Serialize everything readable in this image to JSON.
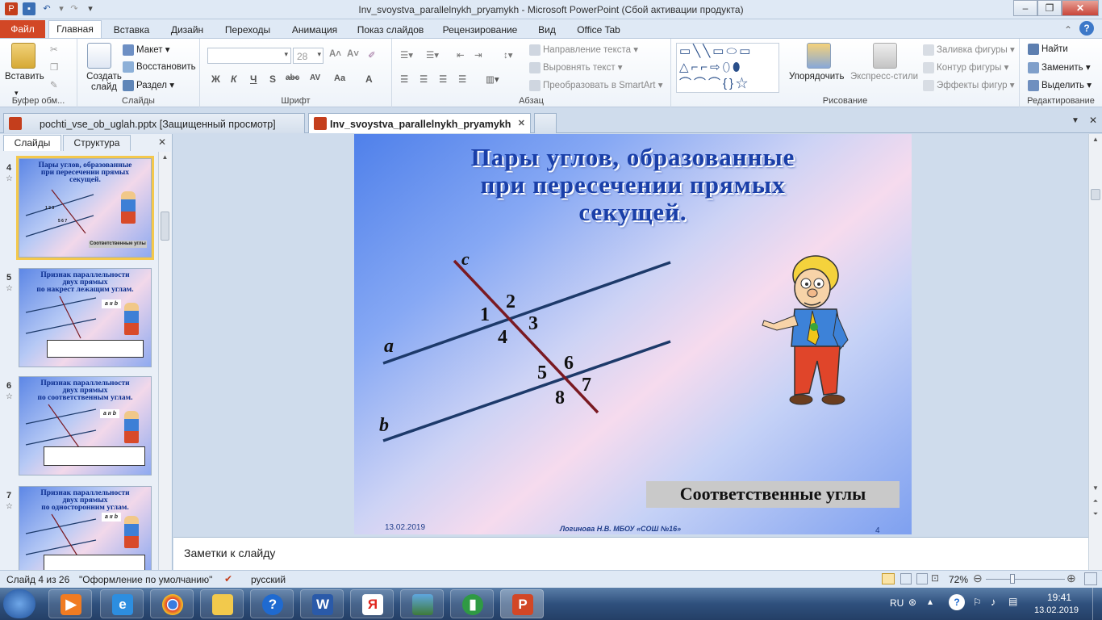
{
  "window": {
    "title": "Inv_svoystva_parallelnykh_pryamykh  -  Microsoft PowerPoint (Сбой активации продукта)"
  },
  "ribbon_tabs": [
    "Файл",
    "Главная",
    "Вставка",
    "Дизайн",
    "Переходы",
    "Анимация",
    "Показ слайдов",
    "Рецензирование",
    "Вид",
    "Office Tab"
  ],
  "ribbon": {
    "clipboard": {
      "paste": "Вставить",
      "label": "Буфер обм..."
    },
    "slides": {
      "new_slide": "Создать слайд",
      "layout": "Макет",
      "reset": "Восстановить",
      "section": "Раздел",
      "label": "Слайды"
    },
    "font": {
      "size": "28",
      "label": "Шрифт"
    },
    "paragraph": {
      "text_direction": "Направление текста",
      "align_text": "Выровнять текст",
      "smartart": "Преобразовать в SmartArt",
      "label": "Абзац"
    },
    "drawing": {
      "arrange": "Упорядочить",
      "quick_styles": "Экспресс-стили",
      "shape_fill": "Заливка фигуры",
      "shape_outline": "Контур фигуры",
      "shape_effects": "Эффекты фигур",
      "label": "Рисование"
    },
    "editing": {
      "find": "Найти",
      "replace": "Заменить",
      "select": "Выделить",
      "label": "Редактирование"
    }
  },
  "doc_tabs": [
    {
      "label": "pochti_vse_ob_uglah.pptx [Защищенный просмотр]",
      "active": false
    },
    {
      "label": "Inv_svoystva_parallelnykh_pryamykh",
      "active": true
    }
  ],
  "left_pane": {
    "tabs": [
      "Слайды",
      "Структура"
    ],
    "thumbnails": [
      {
        "number": "4",
        "title": "Пары углов, образованные\nпри пересечении прямых\nсекущей.",
        "caption": "Соответственные углы",
        "selected": true
      },
      {
        "number": "5",
        "title": "Признак параллельности\nдвух прямых\nпо накрест лежащим углам.",
        "badge": "a ıı b",
        "selected": false
      },
      {
        "number": "6",
        "title": "Признак параллельности\nдвух прямых\nпо соответственным углам.",
        "badge": "a ıı b",
        "selected": false
      },
      {
        "number": "7",
        "title": "Признак параллельности\nдвух прямых\nпо односторонним углам.",
        "badge": "a ıı b",
        "selected": false
      }
    ]
  },
  "slide": {
    "title": "Пары углов, образованные\nпри пересечении прямых\nсекущей.",
    "line_labels": {
      "c": "c",
      "a": "a",
      "b": "b"
    },
    "angle_labels": [
      "1",
      "2",
      "3",
      "4",
      "5",
      "6",
      "7",
      "8"
    ],
    "caption": "Соответственные углы",
    "date": "13.02.2019",
    "footer": "Логинова Н.В.   МБОУ «СОШ №16»",
    "page_number": "4"
  },
  "notes": {
    "placeholder": "Заметки к слайду"
  },
  "status": {
    "slide_info": "Слайд 4 из 26",
    "theme": "\"Оформление по умолчанию\"",
    "language": "русский",
    "zoom": "72%"
  },
  "taskbar": {
    "language": "RU",
    "time": "19:41",
    "date": "13.02.2019"
  },
  "colors": {
    "file_tab": "#d24726",
    "slide_title": "#1a3fa8",
    "line_main": "#1d3a6a",
    "line_secant": "#7a1a22"
  }
}
